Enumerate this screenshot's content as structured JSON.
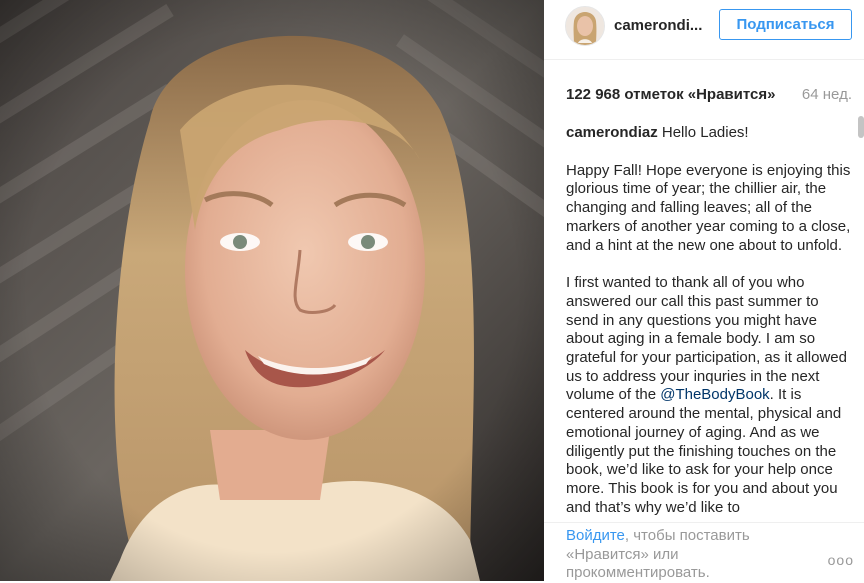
{
  "post": {
    "username": "camerondi...",
    "follow_label": "Подписаться",
    "likes": "122 968 отметок «Нравится»",
    "age": "64 нед.",
    "caption_user": "camerondiaz",
    "caption_first": "Hello Ladies!",
    "caption_p1": "Happy Fall! Hope everyone is enjoying this glorious time of year; the chillier air, the changing and falling leaves; all of the markers of another year coming to a close, and a hint at the new one about to unfold.",
    "caption_p2_before": "I first wanted to thank all of you who answered our call this past summer to send in any questions you might have about aging in a female body. I am so grateful for your participation, as it allowed us to address your inquries in the next volume of the ",
    "caption_mention": "@TheBodyBook",
    "caption_p2_after": ". It is centered around the mental, physical and emotional journey of aging. And as we diligently put the finishing touches on the book, we’d like to ask for your help once more. This book is for you and about you and that’s why we’d like to"
  },
  "footer": {
    "login_link": "Войдите",
    "login_text": ", чтобы поставить «Нравится» или прокомментировать.",
    "more_icon": "ooo"
  }
}
